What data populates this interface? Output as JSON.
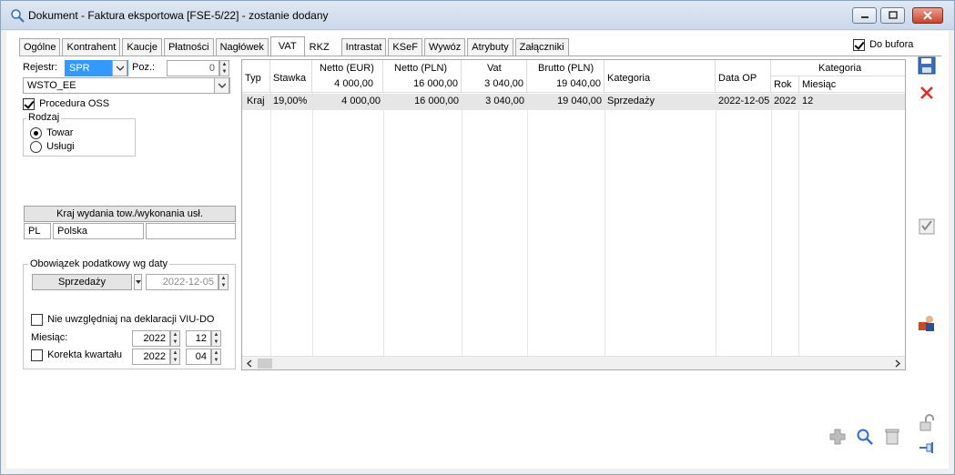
{
  "window": {
    "title": "Dokument - Faktura eksportowa [FSE-5/22]  - zostanie dodany",
    "icons": {
      "app": "search-icon",
      "minimize": "minimize-icon",
      "maximize": "maximize-icon",
      "close": "close-icon"
    }
  },
  "tabs": [
    "Ogólne",
    "Kontrahent",
    "Kaucje",
    "Płatności",
    "Nagłówek",
    "VAT",
    "RKZ",
    "Intrastat",
    "KSeF",
    "Wywóz",
    "Atrybuty",
    "Załączniki"
  ],
  "active_tab": "VAT",
  "do_bufora": {
    "label": "Do bufora",
    "checked": true
  },
  "left": {
    "rejestr_label": "Rejestr:",
    "rejestr_value": "SPR",
    "poz_label": "Poz.:",
    "poz_value": "0",
    "wsto_value": "WSTO_EE",
    "procedura_oss": {
      "label": "Procedura OSS",
      "checked": true
    },
    "rodzaj": {
      "label": "Rodzaj",
      "towar": "Towar",
      "uslugi": "Usługi",
      "selected": "Towar"
    },
    "kraj_header": "Kraj wydania tow./wykonania usł.",
    "kraj_code": "PL",
    "kraj_name": "Polska",
    "kraj_extra": "",
    "obowiazek_label": "Obowiązek podatkowy wg daty",
    "obowiazek_button": "Sprzedaży",
    "obowiazek_date": "2022-12-05",
    "nie_uwzgledniaj": {
      "label": "Nie uwzględniaj na deklaracji VIU-DO",
      "checked": false
    },
    "miesiac_label": "Miesiąc:",
    "miesiac_year": "2022",
    "miesiac_month": "12",
    "korekta": {
      "label": "Korekta kwartału",
      "checked": false
    },
    "korekta_year": "2022",
    "korekta_month": "04"
  },
  "grid": {
    "headers": {
      "typ": "Typ",
      "stawka": "Stawka",
      "netto_eur": "Netto (EUR)",
      "netto_pln": "Netto (PLN)",
      "vat": "Vat",
      "brutto_pln": "Brutto (PLN)",
      "kategoria": "Kategoria",
      "data_op": "Data OP",
      "kategoria2": "Kategoria",
      "rok": "Rok",
      "miesiac": "Miesiąc"
    },
    "totals": {
      "netto_eur": "4 000,00",
      "netto_pln": "16 000,00",
      "vat": "3 040,00",
      "brutto_pln": "19 040,00"
    },
    "rows": [
      {
        "typ": "Kraj",
        "stawka": "19,00%",
        "netto_eur": "4 000,00",
        "netto_pln": "16 000,00",
        "vat": "3 040,00",
        "brutto_pln": "19 040,00",
        "kategoria": "Sprzedaży",
        "data_op": "2022-12-05",
        "rok": "2022",
        "miesiac": "12"
      }
    ]
  },
  "right_toolbar": [
    "save-icon",
    "delete-icon",
    "edit-icon",
    "contractor-icon",
    "lock-icon",
    "pin-icon"
  ],
  "bottom_toolbar": [
    "add-icon",
    "search-icon",
    "trash-icon"
  ]
}
